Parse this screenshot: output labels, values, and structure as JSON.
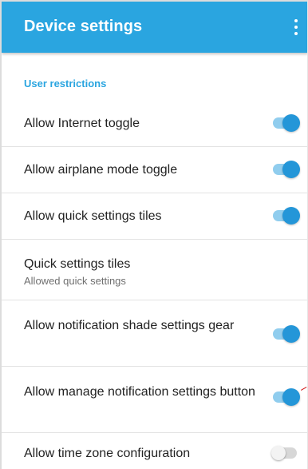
{
  "appbar": {
    "title": "Device settings",
    "menu_icon": "more-vertical-icon"
  },
  "section": {
    "header": "User restrictions"
  },
  "rows": [
    {
      "title": "Allow Internet toggle",
      "switch": "on"
    },
    {
      "title": "Allow airplane mode toggle",
      "switch": "on"
    },
    {
      "title": "Allow quick settings tiles",
      "switch": "on"
    },
    {
      "title": "Quick settings tiles",
      "subtitle": "Allowed quick settings"
    },
    {
      "title": "Allow notification shade settings gear",
      "switch": "on"
    },
    {
      "title": "Allow manage notification settings button",
      "switch": "on"
    },
    {
      "title": "Allow time zone configuration",
      "switch": "off"
    }
  ],
  "colors": {
    "accent": "#2aa5e0",
    "switch_on_thumb": "#2496d8",
    "switch_on_track": "#90cdee",
    "switch_off_track": "#d7d7d7",
    "annotation": "#d01010"
  }
}
